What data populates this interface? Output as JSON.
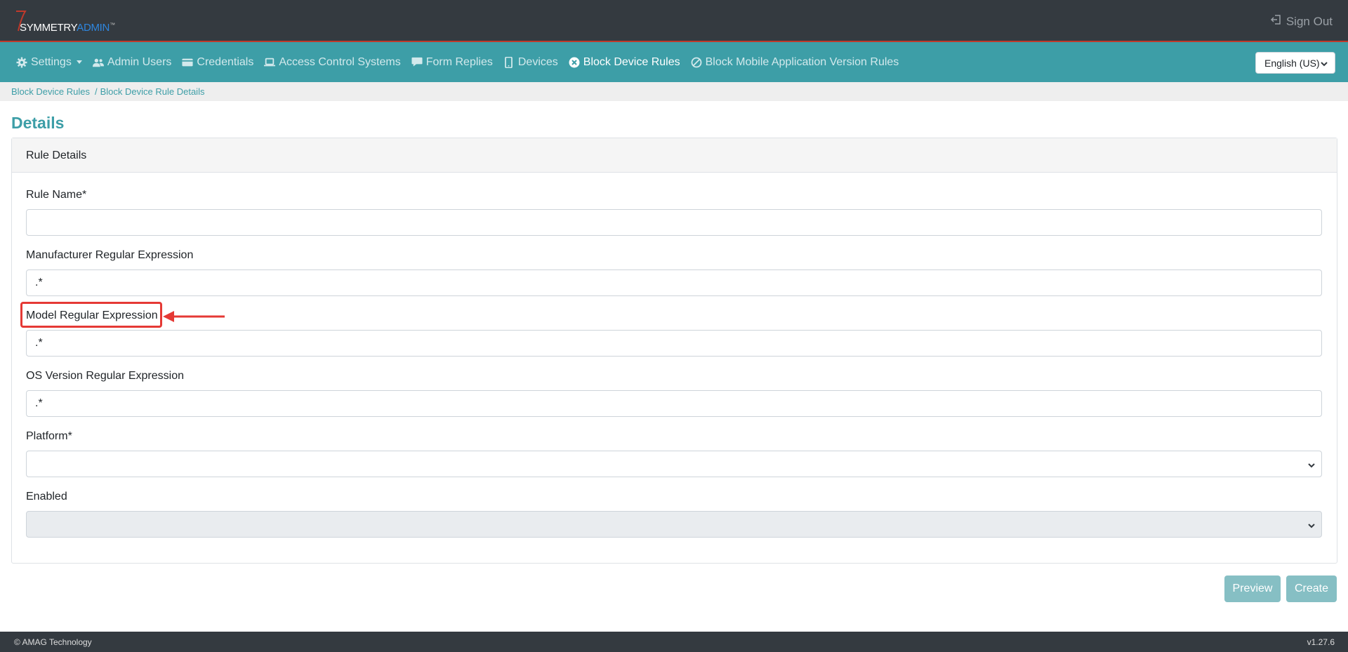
{
  "header": {
    "logo_main": "SYMMETRY",
    "logo_accent": "ADMIN",
    "logo_tm": "™",
    "sign_out_label": "Sign Out"
  },
  "nav": {
    "items": [
      {
        "label": "Settings",
        "icon": "gear-icon",
        "has_dropdown": true
      },
      {
        "label": "Admin Users",
        "icon": "users-icon"
      },
      {
        "label": "Credentials",
        "icon": "card-icon"
      },
      {
        "label": "Access Control Systems",
        "icon": "laptop-icon"
      },
      {
        "label": "Form Replies",
        "icon": "comment-icon"
      },
      {
        "label": "Devices",
        "icon": "phone-icon"
      },
      {
        "label": "Block Device Rules",
        "icon": "x-circle-icon",
        "active": true
      },
      {
        "label": "Block Mobile Application Version Rules",
        "icon": "ban-icon"
      }
    ],
    "language": "English (US)"
  },
  "breadcrumb": {
    "parent": "Block Device Rules",
    "separator": "/",
    "current": "Block Device Rule Details"
  },
  "page": {
    "title": "Details"
  },
  "card": {
    "header": "Rule Details",
    "fields": {
      "rule_name": {
        "label": "Rule Name*",
        "value": ""
      },
      "manufacturer": {
        "label": "Manufacturer Regular Expression",
        "value": ".*"
      },
      "model": {
        "label": "Model Regular Expression",
        "value": ".*"
      },
      "os_version": {
        "label": "OS Version Regular Expression",
        "value": ".*"
      },
      "platform": {
        "label": "Platform*",
        "value": ""
      },
      "enabled": {
        "label": "Enabled",
        "value": ""
      }
    }
  },
  "buttons": {
    "preview": "Preview",
    "create": "Create"
  },
  "footer": {
    "copyright": "© AMAG Technology",
    "version": "v1.27.6"
  },
  "colors": {
    "topbar": "#343a40",
    "navbar": "#3d9ea7",
    "accent": "#3d9ea7",
    "button": "#86bfc4",
    "annotation": "#e53935"
  }
}
